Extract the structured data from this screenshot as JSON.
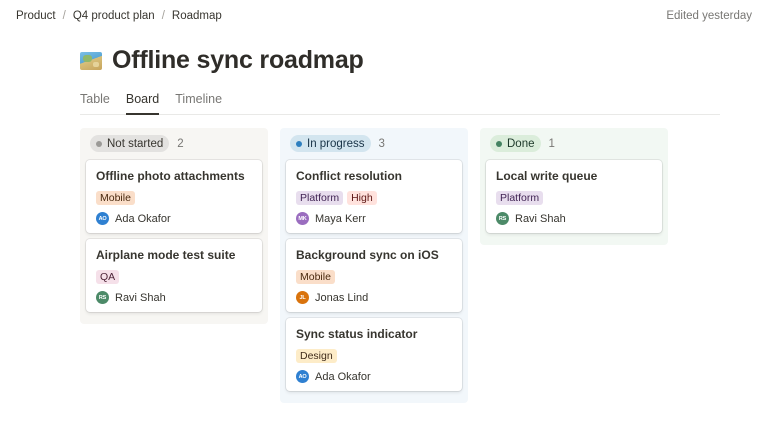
{
  "breadcrumbs": [
    "Product",
    "Q4 product plan",
    "Roadmap"
  ],
  "edited": "Edited yesterday",
  "page": {
    "title": "Offline sync roadmap",
    "icon": "map-icon"
  },
  "tabs": [
    "Table",
    "Board",
    "Timeline"
  ],
  "active_tab": "Board",
  "columns": [
    {
      "label": "Not started",
      "count": "2",
      "dot": "#9b9a97",
      "cards": [
        {
          "title": "Offline photo attachments",
          "tags": [
            {
              "label": "Mobile",
              "bg": "#fadec9",
              "fg": "#49290e"
            }
          ],
          "assignee": {
            "initials": "AO",
            "name": "Ada Okafor",
            "color": "#2f80d1"
          }
        },
        {
          "title": "Airplane mode test suite",
          "tags": [
            {
              "label": "QA",
              "bg": "#f5e0e9",
              "fg": "#4c2337"
            }
          ],
          "assignee": {
            "initials": "RS",
            "name": "Ravi Shah",
            "color": "#4c8a68"
          }
        }
      ]
    },
    {
      "label": "In progress",
      "count": "3",
      "dot": "#2e7fbf",
      "cards": [
        {
          "title": "Conflict resolution",
          "tags": [
            {
              "label": "Platform",
              "bg": "#e8deee",
              "fg": "#412454"
            },
            {
              "label": "High",
              "bg": "#ffe2dd",
              "fg": "#5d1715"
            }
          ],
          "assignee": {
            "initials": "MK",
            "name": "Maya Kerr",
            "color": "#9a6dbf"
          }
        },
        {
          "title": "Background sync on iOS",
          "tags": [
            {
              "label": "Mobile",
              "bg": "#fadec9",
              "fg": "#49290e"
            }
          ],
          "assignee": {
            "initials": "JL",
            "name": "Jonas Lind",
            "color": "#d9730d"
          }
        },
        {
          "title": "Sync status indicator",
          "tags": [
            {
              "label": "Design",
              "bg": "#fdecc8",
              "fg": "#402c1b"
            }
          ],
          "assignee": {
            "initials": "AO",
            "name": "Ada Okafor",
            "color": "#2f80d1"
          }
        }
      ]
    },
    {
      "label": "Done",
      "count": "1",
      "dot": "#448361",
      "cards": [
        {
          "title": "Local write queue",
          "tags": [
            {
              "label": "Platform",
              "bg": "#e8deee",
              "fg": "#412454"
            }
          ],
          "assignee": {
            "initials": "RS",
            "name": "Ravi Shah",
            "color": "#4c8a68"
          }
        }
      ]
    }
  ]
}
